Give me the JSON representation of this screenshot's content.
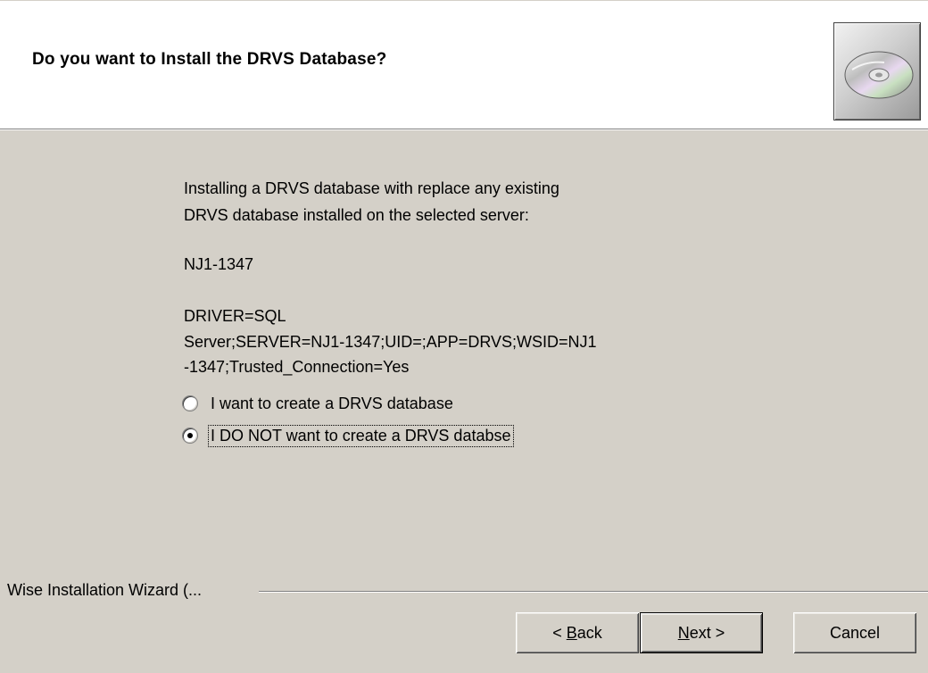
{
  "header": {
    "title": "Do you want to Install the DRVS Database?",
    "icon": "cd-disc-icon"
  },
  "body": {
    "intro_line1": "Installing a DRVS database with replace any existing",
    "intro_line2": "DRVS database installed on the selected server:",
    "server_name": "NJ1-1347",
    "connection_line1": "DRIVER=SQL",
    "connection_line2": "Server;SERVER=NJ1-1347;UID=;APP=DRVS;WSID=NJ1",
    "connection_line3": "-1347;Trusted_Connection=Yes"
  },
  "options": [
    {
      "label": "I want to create a DRVS database",
      "selected": false
    },
    {
      "label": "I DO NOT want to create a DRVS databse",
      "selected": true
    }
  ],
  "footer": {
    "group_label": "Wise Installation Wizard (...",
    "back_button": {
      "prefix": "< ",
      "mnemonic": "B",
      "rest": "ack"
    },
    "next_button": {
      "mnemonic": "N",
      "rest": "ext >"
    },
    "cancel_button": "Cancel"
  }
}
